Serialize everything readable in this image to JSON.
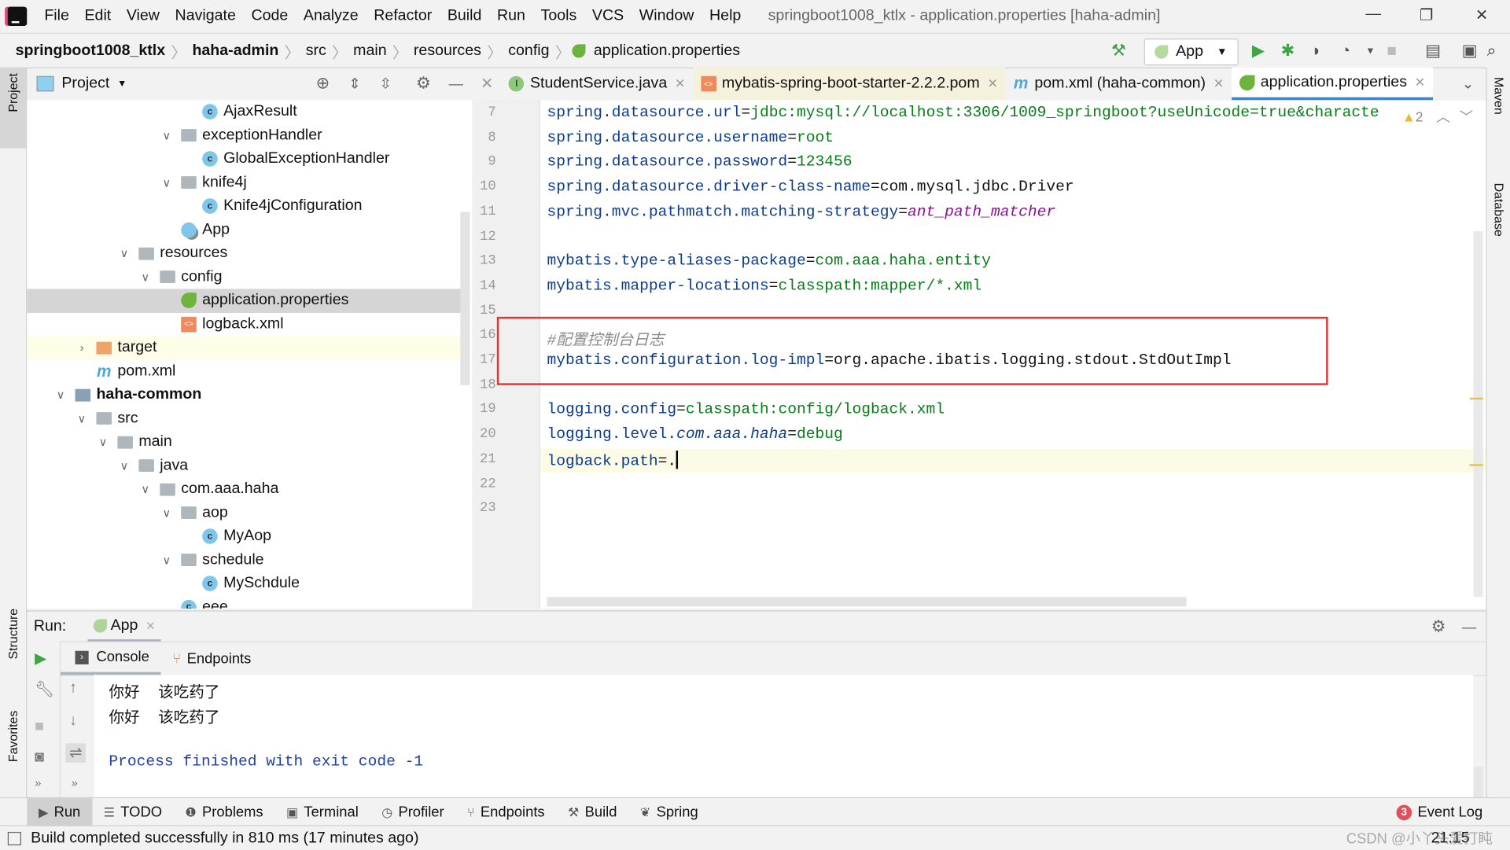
{
  "window": {
    "title": "springboot1008_ktlx - application.properties [haha-admin]"
  },
  "menu": [
    "File",
    "Edit",
    "View",
    "Navigate",
    "Code",
    "Analyze",
    "Refactor",
    "Build",
    "Run",
    "Tools",
    "VCS",
    "Window",
    "Help"
  ],
  "breadcrumb": [
    "springboot1008_ktlx",
    "haha-admin",
    "src",
    "main",
    "resources",
    "config",
    "application.properties"
  ],
  "toolbar": {
    "run_config": "App"
  },
  "left_strip": {
    "project": "Project",
    "structure": "Structure",
    "favorites": "Favorites"
  },
  "right_strip": {
    "maven": "Maven",
    "database": "Database"
  },
  "project_panel": {
    "title": "Project",
    "tree": [
      {
        "label": "AjaxResult",
        "level": 8,
        "icon": "class"
      },
      {
        "label": "exceptionHandler",
        "level": 7,
        "icon": "folder",
        "expanded": true
      },
      {
        "label": "GlobalExceptionHandler",
        "level": 8,
        "icon": "class"
      },
      {
        "label": "knife4j",
        "level": 7,
        "icon": "folder",
        "expanded": true
      },
      {
        "label": "Knife4jConfiguration",
        "level": 8,
        "icon": "class"
      },
      {
        "label": "App",
        "level": 7,
        "icon": "app"
      },
      {
        "label": "resources",
        "level": 5,
        "icon": "folder",
        "expanded": true
      },
      {
        "label": "config",
        "level": 6,
        "icon": "folder",
        "expanded": true
      },
      {
        "label": "application.properties",
        "level": 7,
        "icon": "spring",
        "selected": true
      },
      {
        "label": "logback.xml",
        "level": 7,
        "icon": "xml"
      },
      {
        "label": "target",
        "level": 3,
        "icon": "folder-orange",
        "expanded": false,
        "highlight": true
      },
      {
        "label": "pom.xml",
        "level": 3,
        "icon": "maven"
      },
      {
        "label": "haha-common",
        "level": 2,
        "icon": "module",
        "expanded": true,
        "bold": true
      },
      {
        "label": "src",
        "level": 3,
        "icon": "folder",
        "expanded": true
      },
      {
        "label": "main",
        "level": 4,
        "icon": "folder",
        "expanded": true
      },
      {
        "label": "java",
        "level": 5,
        "icon": "folder",
        "expanded": true
      },
      {
        "label": "com.aaa.haha",
        "level": 6,
        "icon": "folder",
        "expanded": true
      },
      {
        "label": "aop",
        "level": 7,
        "icon": "folder",
        "expanded": true
      },
      {
        "label": "MyAop",
        "level": 8,
        "icon": "class"
      },
      {
        "label": "schedule",
        "level": 7,
        "icon": "folder",
        "expanded": true
      },
      {
        "label": "MySchdule",
        "level": 8,
        "icon": "class"
      },
      {
        "label": "eee",
        "level": 7,
        "icon": "class"
      }
    ]
  },
  "editor": {
    "tabs": [
      {
        "label": "StudentService.java",
        "icon": "interface"
      },
      {
        "label": "mybatis-spring-boot-starter-2.2.2.pom",
        "icon": "xml"
      },
      {
        "label": "pom.xml (haha-common)",
        "icon": "maven"
      },
      {
        "label": "application.properties",
        "icon": "spring",
        "active": true
      }
    ],
    "warnings": "2",
    "current_line": 21,
    "highlighted_lines": [
      16,
      17
    ],
    "lines": [
      {
        "n": "7",
        "seg": [
          [
            "k",
            "spring.datasource.url"
          ],
          [
            "p",
            "="
          ],
          [
            "v",
            "jdbc:mysql://localhost:3306/1009_springboot?useUnicode=true&characte"
          ]
        ]
      },
      {
        "n": "8",
        "seg": [
          [
            "k",
            "spring.datasource.username"
          ],
          [
            "p",
            "="
          ],
          [
            "v",
            "root"
          ]
        ]
      },
      {
        "n": "9",
        "seg": [
          [
            "k",
            "spring.datasource.password"
          ],
          [
            "p",
            "="
          ],
          [
            "v",
            "123456"
          ]
        ]
      },
      {
        "n": "10",
        "seg": [
          [
            "k",
            "spring.datasource.driver-class-name"
          ],
          [
            "p",
            "=com.mysql.jdbc.Driver"
          ]
        ]
      },
      {
        "n": "11",
        "seg": [
          [
            "k",
            "spring.mvc.pathmatch.matching-strategy"
          ],
          [
            "p",
            "="
          ],
          [
            "e",
            "ant_path_matcher"
          ]
        ]
      },
      {
        "n": "12",
        "seg": []
      },
      {
        "n": "13",
        "seg": [
          [
            "k",
            "mybatis.type-aliases-package"
          ],
          [
            "p",
            "="
          ],
          [
            "v",
            "com.aaa.haha.entity"
          ]
        ]
      },
      {
        "n": "14",
        "seg": [
          [
            "k",
            "mybatis.mapper-locations"
          ],
          [
            "p",
            "="
          ],
          [
            "v",
            "classpath:mapper/*.xml"
          ]
        ]
      },
      {
        "n": "15",
        "seg": []
      },
      {
        "n": "16",
        "seg": [
          [
            "c",
            "#配置控制台日志"
          ]
        ]
      },
      {
        "n": "17",
        "seg": [
          [
            "k",
            "mybatis.configuration.log-impl"
          ],
          [
            "p",
            "=org.apache.ibatis.logging.stdout.StdOutImpl"
          ]
        ]
      },
      {
        "n": "18",
        "seg": []
      },
      {
        "n": "19",
        "seg": [
          [
            "k",
            "logging.config"
          ],
          [
            "p",
            "="
          ],
          [
            "v",
            "classpath:config/logback.xml"
          ]
        ]
      },
      {
        "n": "20",
        "seg": [
          [
            "k",
            "logging.level."
          ],
          [
            "ki",
            "com.aaa.haha"
          ],
          [
            "p",
            "="
          ],
          [
            "v",
            "debug"
          ]
        ]
      },
      {
        "n": "21",
        "seg": [
          [
            "k",
            "logback.path"
          ],
          [
            "p",
            "=."
          ]
        ]
      },
      {
        "n": "22",
        "seg": []
      },
      {
        "n": "23",
        "seg": []
      }
    ]
  },
  "run_panel": {
    "label": "Run:",
    "tab": "App",
    "subtabs": [
      "Console",
      "Endpoints"
    ],
    "console": [
      "你好  该吃药了",
      "你好  该吃药了",
      "",
      "Process finished with exit code -1"
    ]
  },
  "bottom_tools": [
    "Run",
    "TODO",
    "Problems",
    "Terminal",
    "Profiler",
    "Endpoints",
    "Build",
    "Spring"
  ],
  "event_log": {
    "label": "Event Log",
    "count": "3"
  },
  "status": {
    "message": "Build completed successfully in 810 ms (17 minutes ago)",
    "position": "21:15",
    "watermark": "CSDN @小丫头爱打盹"
  },
  "colors": {
    "accent": "#4083c9",
    "highlight_box": "#e53333",
    "key": "#0b3c8f",
    "value": "#067d17",
    "enum": "#871094",
    "comment": "#8c8c8c"
  }
}
